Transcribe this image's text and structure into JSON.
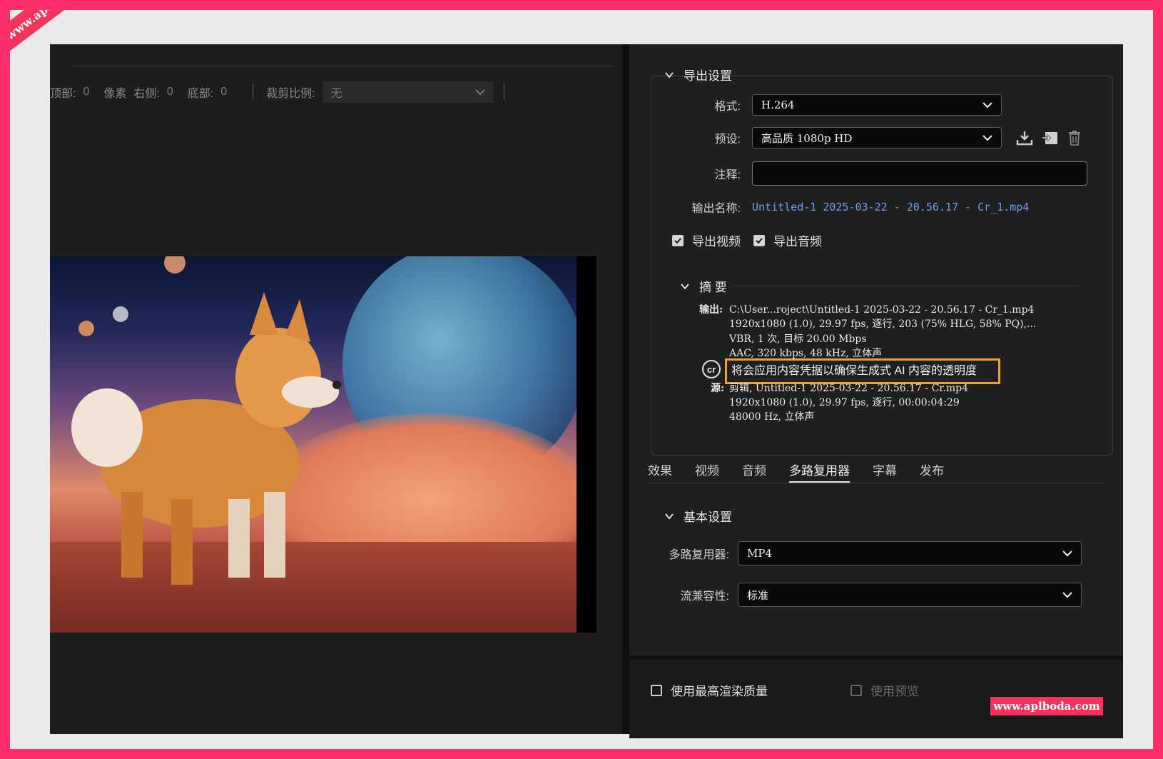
{
  "watermark": {
    "text": "www.aplboda.com"
  },
  "crop": {
    "top_label": "顶部:",
    "top_value": "0",
    "pixel_label": "像素",
    "right_label": "右侧:",
    "right_value": "0",
    "bottom_label": "底部:",
    "bottom_value": "0",
    "ratio_label": "裁剪比例:",
    "ratio_value": "无"
  },
  "export_settings": {
    "title": "导出设置",
    "format_label": "格式:",
    "format_value": "H.264",
    "preset_label": "预设:",
    "preset_value": "高品质 1080p HD",
    "comment_label": "注释:",
    "comment_value": "",
    "output_name_label": "输出名称:",
    "output_name_value": "Untitled-1 2025-03-22 - 20.56.17 - Cr_1.mp4",
    "export_video_label": "导出视频",
    "export_video_checked": true,
    "export_audio_label": "导出音频",
    "export_audio_checked": true
  },
  "summary": {
    "title": "摘 要",
    "output_label": "输出:",
    "output_lines": [
      "C:\\User...roject\\Untitled-1 2025-03-22 - 20.56.17 - Cr_1.mp4",
      "1920x1080 (1.0), 29.97 fps, 逐行, 203 (75% HLG, 58% PQ),...",
      "VBR, 1 次, 目标 20.00 Mbps",
      "AAC, 320 kbps, 48 kHz, 立体声"
    ],
    "cr_icon": "cr",
    "cr_notice": "将会应用内容凭据以确保生成式 AI 内容的透明度",
    "source_label": "源:",
    "source_lines": [
      "剪辑, Untitled-1 2025-03-22 - 20.56.17 - Cr.mp4",
      "1920x1080 (1.0), 29.97 fps, 逐行, 00:00:04:29",
      "48000 Hz, 立体声"
    ]
  },
  "tabs": [
    {
      "label": "效果",
      "active": false
    },
    {
      "label": "视频",
      "active": false
    },
    {
      "label": "音频",
      "active": false
    },
    {
      "label": "多路复用器",
      "active": true
    },
    {
      "label": "字幕",
      "active": false
    },
    {
      "label": "发布",
      "active": false
    }
  ],
  "basic_settings": {
    "title": "基本设置",
    "multiplexer_label": "多路复用器:",
    "multiplexer_value": "MP4",
    "compat_label": "流兼容性:",
    "compat_value": "标准"
  },
  "footer": {
    "max_quality_label": "使用最高渲染质量",
    "max_quality_checked": false,
    "use_preview_label": "使用预览",
    "use_preview_checked": false
  },
  "colors": {
    "accent_link": "#6ea0e8",
    "highlight_border": "#f0a030",
    "watermark_bg": "#f0345c",
    "page_border": "#ff2d6a"
  }
}
